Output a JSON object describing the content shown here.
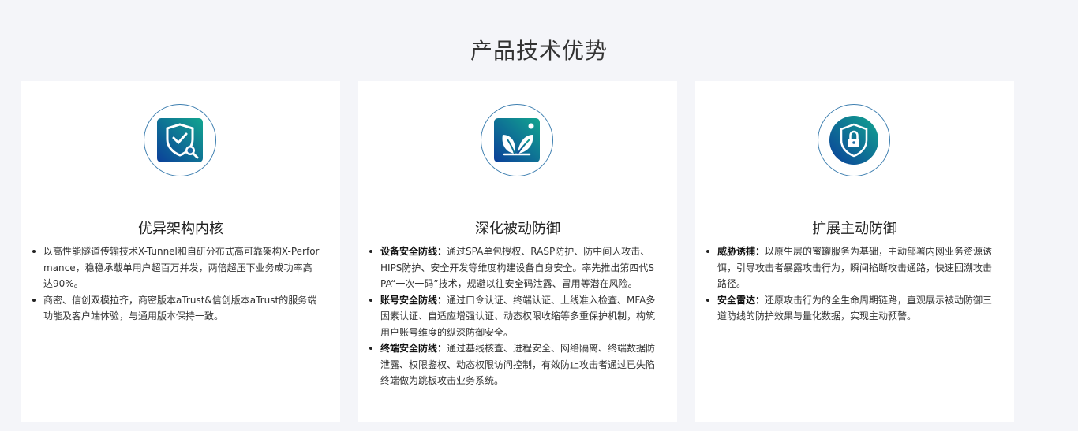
{
  "section_title": "产品技术优势",
  "cards": [
    {
      "icon": "shield-check-search-icon",
      "title": "优异架构内核",
      "items": [
        {
          "label": "",
          "text": "以高性能隧道传输技术X-Tunnel和自研分布式高可靠架构X-Performance，稳稳承载单用户超百万并发，两倍超压下业务成功率高达90%。"
        },
        {
          "label": "",
          "text": "商密、信创双模拉齐，商密版本aTrust&信创版本aTrust的服务端功能及客户端体验，与通用版本保持一致。"
        }
      ]
    },
    {
      "icon": "leaf-icon",
      "title": "深化被动防御",
      "items": [
        {
          "label": "设备安全防线：",
          "text": "通过SPA单包授权、RASP防护、防中间人攻击、HIPS防护、安全开发等维度构建设备自身安全。率先推出第四代SPA“一次一码”技术，规避以往安全码泄露、冒用等潜在风险。"
        },
        {
          "label": "账号安全防线：",
          "text": "通过口令认证、终端认证、上线准入检查、MFA多因素认证、自适应增强认证、动态权限收缩等多重保护机制，构筑用户账号维度的纵深防御安全。"
        },
        {
          "label": "终端安全防线：",
          "text": "通过基线核查、进程安全、网络隔离、终端数据防泄露、权限鉴权、动态权限访问控制，有效防止攻击者通过已失陷终端做为跳板攻击业务系统。"
        }
      ]
    },
    {
      "icon": "shield-lock-icon",
      "title": "扩展主动防御",
      "items": [
        {
          "label": "威胁诱捕：",
          "text": "以原生层的蜜罐服务为基础，主动部署内网业务资源诱饵，引导攻击者暴露攻击行为，瞬间掐断攻击通路，快速回溯攻击路径。"
        },
        {
          "label": "安全雷达：",
          "text": "还原攻击行为的全生命周期链路，直观展示被动防御三道防线的防护效果与量化数据，实现主动预警。"
        }
      ]
    }
  ]
}
